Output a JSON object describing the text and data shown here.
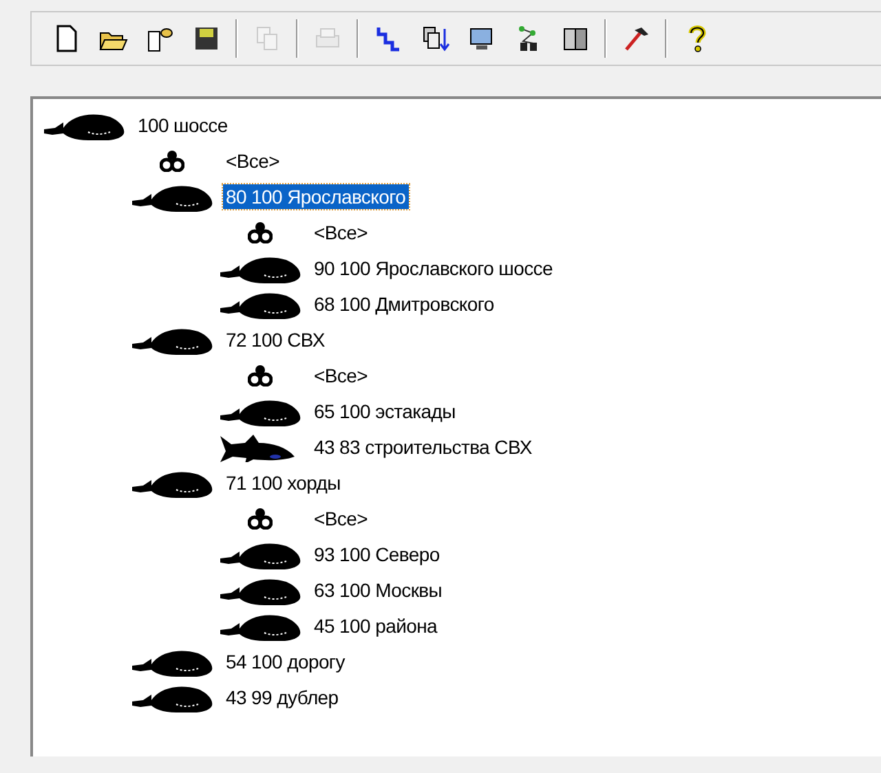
{
  "toolbar": [
    {
      "kind": "new",
      "disabled": false
    },
    {
      "kind": "open",
      "disabled": false
    },
    {
      "kind": "import",
      "disabled": false
    },
    {
      "kind": "save",
      "disabled": false
    },
    {
      "kind": "separator"
    },
    {
      "kind": "copy",
      "disabled": true
    },
    {
      "kind": "separator"
    },
    {
      "kind": "print",
      "disabled": true
    },
    {
      "kind": "separator"
    },
    {
      "kind": "route",
      "disabled": false
    },
    {
      "kind": "sort",
      "disabled": false
    },
    {
      "kind": "monitor",
      "disabled": false
    },
    {
      "kind": "tree",
      "disabled": false
    },
    {
      "kind": "compare",
      "disabled": false
    },
    {
      "kind": "separator"
    },
    {
      "kind": "hammer",
      "disabled": false
    },
    {
      "kind": "separator"
    },
    {
      "kind": "help",
      "disabled": false
    }
  ],
  "tree": [
    {
      "kind": "whale",
      "label": "100 шоссе",
      "selected": false,
      "children": [
        {
          "kind": "filter",
          "label": "<Все>",
          "selected": false
        },
        {
          "kind": "whale",
          "label": "80 100 Ярославского",
          "selected": true,
          "children": [
            {
              "kind": "filter",
              "label": "<Все>",
              "selected": false
            },
            {
              "kind": "whale",
              "label": "90 100 Ярославского шоссе",
              "selected": false
            },
            {
              "kind": "whale",
              "label": "68 100 Дмитровского",
              "selected": false
            }
          ]
        },
        {
          "kind": "whale",
          "label": "72 100 СВХ",
          "selected": false,
          "children": [
            {
              "kind": "filter",
              "label": "<Все>",
              "selected": false
            },
            {
              "kind": "whale",
              "label": "65 100 эстакады",
              "selected": false
            },
            {
              "kind": "shark",
              "label": "43 83 строительства СВХ",
              "selected": false
            }
          ]
        },
        {
          "kind": "whale",
          "label": "71 100 хорды",
          "selected": false,
          "children": [
            {
              "kind": "filter",
              "label": "<Все>",
              "selected": false
            },
            {
              "kind": "whale",
              "label": "93 100 Северо",
              "selected": false
            },
            {
              "kind": "whale",
              "label": "63 100 Москвы",
              "selected": false
            },
            {
              "kind": "whale",
              "label": "45 100 района",
              "selected": false
            }
          ]
        },
        {
          "kind": "whale",
          "label": "54 100 дорогу",
          "selected": false
        },
        {
          "kind": "whale",
          "label": "43 99 дублер",
          "selected": false
        }
      ]
    }
  ]
}
